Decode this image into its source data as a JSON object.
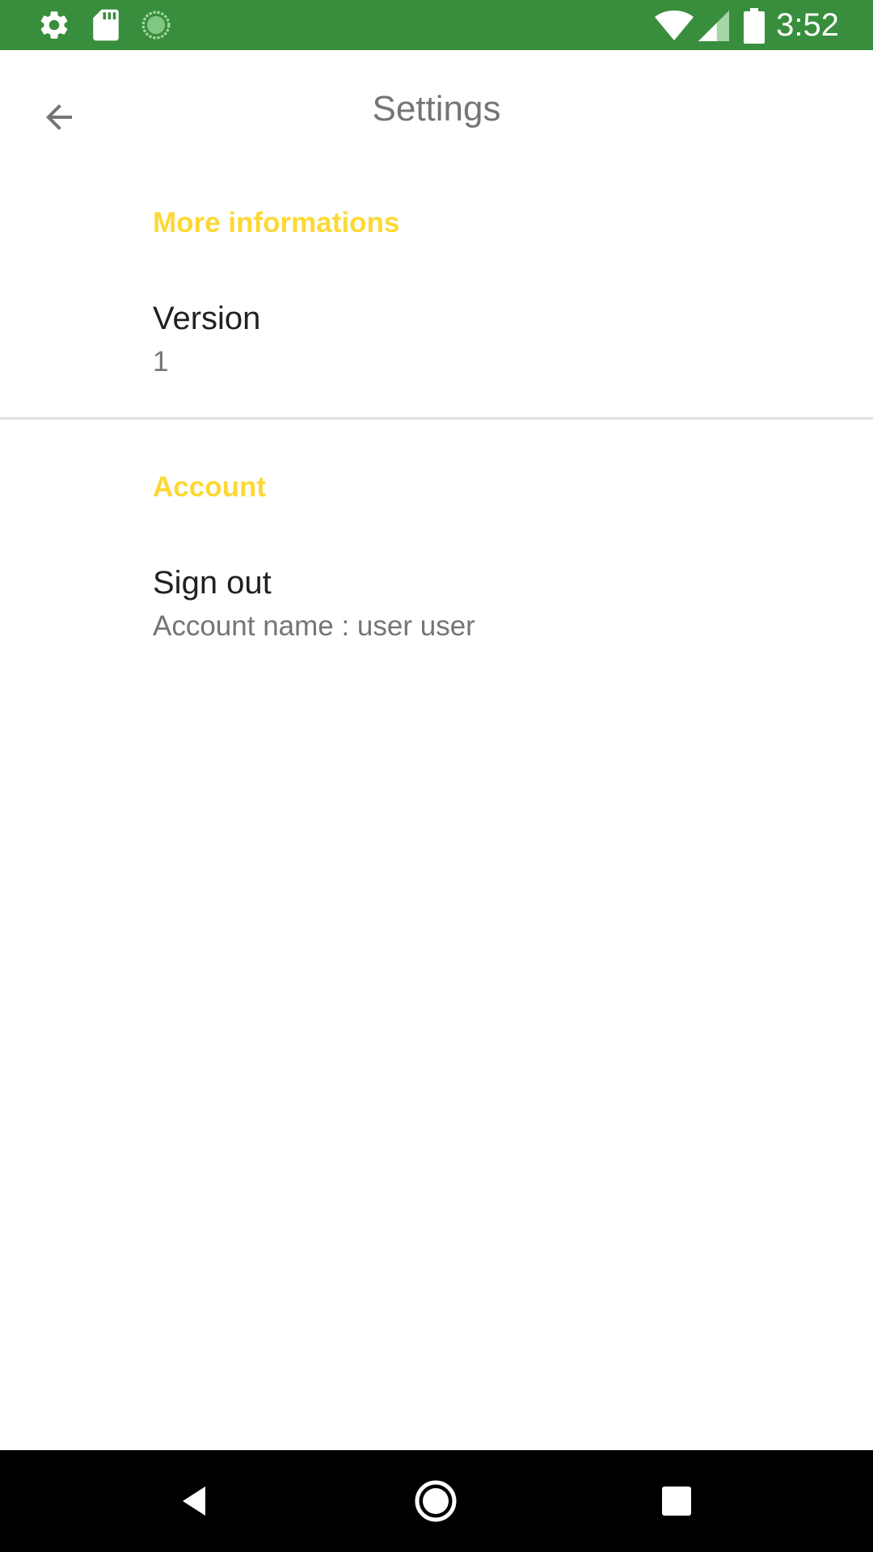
{
  "status_bar": {
    "time": "3:52",
    "background_color": "#388e3c",
    "left_icons": [
      "gear-icon",
      "sd-card-icon",
      "sync-progress-icon"
    ],
    "right_icons": [
      "wifi-icon",
      "cell-signal-icon",
      "battery-icon"
    ]
  },
  "app_bar": {
    "title": "Settings",
    "back_icon": "arrow-back-icon"
  },
  "sections": [
    {
      "header": "More informations",
      "items": [
        {
          "title": "Version",
          "summary": "1"
        }
      ]
    },
    {
      "header": "Account",
      "items": [
        {
          "title": "Sign out",
          "summary": "Account name : user user"
        }
      ]
    }
  ],
  "colors": {
    "category_accent": "#fdd835",
    "title_text": "#212121",
    "secondary_text": "#757575"
  },
  "nav_bar": {
    "icons": [
      "back-triangle-icon",
      "home-circle-icon",
      "recents-square-icon"
    ]
  }
}
